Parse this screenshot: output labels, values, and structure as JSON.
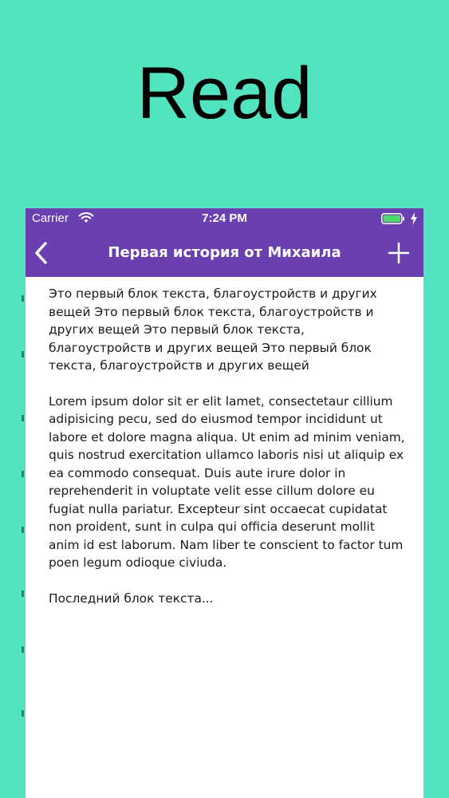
{
  "hero": {
    "title": "Read"
  },
  "status_bar": {
    "carrier": "Carrier",
    "time": "7:24 PM"
  },
  "nav_bar": {
    "title": "Первая история от Михаила",
    "back_icon": "chevron-left-icon",
    "add_icon": "plus-icon"
  },
  "content": {
    "paragraphs": [
      "Это первый блок текста, благоустройств и других вещей Это первый блок текста, благоустройств и других вещей Это первый блок текста, благоустройств и других вещей Это первый блок текста, благоустройств и других вещей",
      "Lorem ipsum dolor sit er elit lamet, consectetaur cillium adipisicing pecu, sed do eiusmod tempor incididunt ut labore et dolore magna aliqua. Ut enim ad minim veniam, quis nostrud exercitation ullamco laboris nisi ut aliquip ex ea commodo consequat. Duis aute irure dolor in reprehenderit in voluptate velit esse cillum dolore eu fugiat nulla pariatur. Excepteur sint occaecat cupidatat non proident, sunt in culpa qui officia deserunt mollit anim id est laborum. Nam liber te conscient to factor tum poen legum odioque civiuda.",
      "Последний блок текста..."
    ]
  },
  "colors": {
    "background": "#52e3c1",
    "nav": "#6a3fb0",
    "battery": "#4cd964"
  }
}
